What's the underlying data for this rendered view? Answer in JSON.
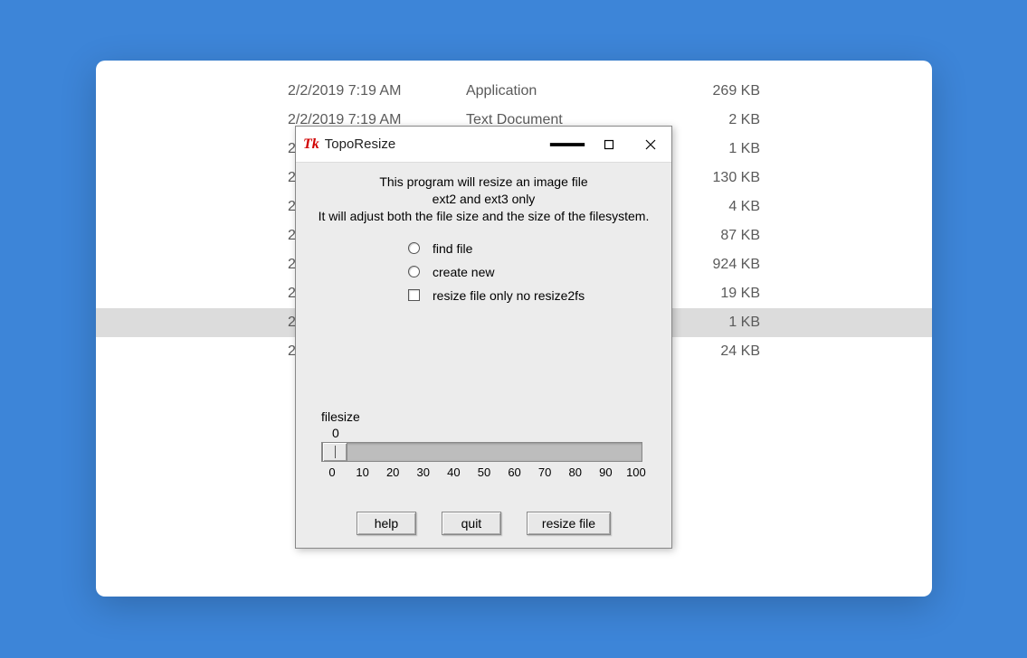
{
  "explorer": {
    "rows": [
      {
        "date": "2/2/2019 7:19 AM",
        "type": "Application",
        "size": "269 KB",
        "selected": false
      },
      {
        "date": "2/2/2019 7:19 AM",
        "type": "Text Document",
        "size": "2 KB",
        "selected": false
      },
      {
        "date": "2",
        "type": "",
        "size": "1 KB",
        "selected": false
      },
      {
        "date": "2",
        "type": "",
        "size": "130 KB",
        "selected": false
      },
      {
        "date": "2",
        "type": "",
        "size": "4 KB",
        "selected": false
      },
      {
        "date": "2",
        "type": "",
        "size": "87 KB",
        "selected": false
      },
      {
        "date": "2",
        "type": "",
        "size": "924 KB",
        "selected": false
      },
      {
        "date": "2",
        "type": "",
        "size": "19 KB",
        "selected": false
      },
      {
        "date": "2",
        "type": "",
        "size": "1 KB",
        "selected": true
      },
      {
        "date": "2",
        "type": "",
        "size": "24 KB",
        "selected": false
      }
    ]
  },
  "dialog": {
    "app_icon_label": "Tk",
    "title": "TopoResize",
    "description_line1": "This program will resize an  image file",
    "description_line2": "ext2 and ext3 only",
    "description_line3": "It will adjust both the file size and the size of the filesystem.",
    "option_find_file": "find file",
    "option_create_new": "create new",
    "option_resize_only": "resize file only no resize2fs",
    "slider": {
      "label": "filesize",
      "value": "0",
      "ticks": [
        "0",
        "10",
        "20",
        "30",
        "40",
        "50",
        "60",
        "70",
        "80",
        "90",
        "100"
      ]
    },
    "buttons": {
      "help": "help",
      "quit": "quit",
      "resize": "resize file"
    }
  }
}
